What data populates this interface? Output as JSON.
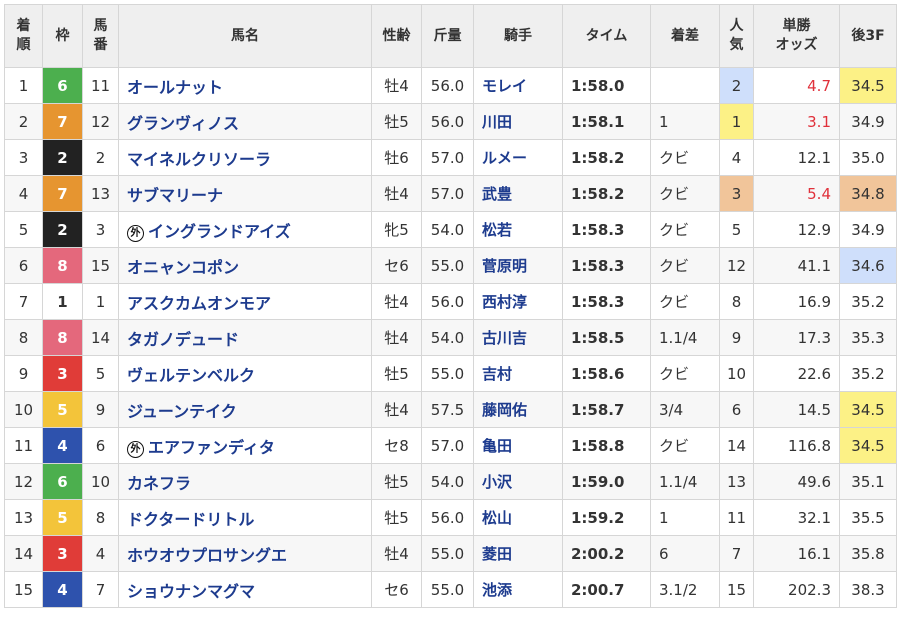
{
  "headers": {
    "rank": [
      "着",
      "順"
    ],
    "waku": "枠",
    "num": [
      "馬",
      "番"
    ],
    "name": "馬名",
    "sexage": "性齢",
    "weight": "斤量",
    "jockey": "騎手",
    "time": "タイム",
    "margin": "着差",
    "pop": [
      "人",
      "気"
    ],
    "odds": [
      "単勝",
      "オッズ"
    ],
    "last3f": "後3F"
  },
  "waku_colors": {
    "1": "#ffffff",
    "2": "#222222",
    "3": "#e03c38",
    "4": "#2e52ad",
    "5": "#f3c43a",
    "6": "#4caf4e",
    "7": "#e69530",
    "8": "#e4687c"
  },
  "rows": [
    {
      "rank": "1",
      "waku": "6",
      "num": "11",
      "foreign": false,
      "name": "オールナット",
      "sexage": "牡4",
      "weight": "56.0",
      "jockey": "モレイ",
      "time": "1:58.0",
      "margin": "",
      "pop": "2",
      "odds": "4.7",
      "last3f": "34.5",
      "f3rank": 1
    },
    {
      "rank": "2",
      "waku": "7",
      "num": "12",
      "foreign": false,
      "name": "グランヴィノス",
      "sexage": "牡5",
      "weight": "56.0",
      "jockey": "川田",
      "time": "1:58.1",
      "margin": "1",
      "pop": "1",
      "odds": "3.1",
      "last3f": "34.9",
      "f3rank": 0
    },
    {
      "rank": "3",
      "waku": "2",
      "num": "2",
      "foreign": false,
      "name": "マイネルクリソーラ",
      "sexage": "牡6",
      "weight": "57.0",
      "jockey": "ルメー",
      "time": "1:58.2",
      "margin": "クビ",
      "pop": "4",
      "odds": "12.1",
      "last3f": "35.0",
      "f3rank": 0
    },
    {
      "rank": "4",
      "waku": "7",
      "num": "13",
      "foreign": false,
      "name": "サブマリーナ",
      "sexage": "牡4",
      "weight": "57.0",
      "jockey": "武豊",
      "time": "1:58.2",
      "margin": "クビ",
      "pop": "3",
      "odds": "5.4",
      "last3f": "34.8",
      "f3rank": 3
    },
    {
      "rank": "5",
      "waku": "2",
      "num": "3",
      "foreign": true,
      "name": "イングランドアイズ",
      "sexage": "牝5",
      "weight": "54.0",
      "jockey": "松若",
      "time": "1:58.3",
      "margin": "クビ",
      "pop": "5",
      "odds": "12.9",
      "last3f": "34.9",
      "f3rank": 0
    },
    {
      "rank": "6",
      "waku": "8",
      "num": "15",
      "foreign": false,
      "name": "オニャンコポン",
      "sexage": "セ6",
      "weight": "55.0",
      "jockey": "菅原明",
      "time": "1:58.3",
      "margin": "クビ",
      "pop": "12",
      "odds": "41.1",
      "last3f": "34.6",
      "f3rank": 2
    },
    {
      "rank": "7",
      "waku": "1",
      "num": "1",
      "foreign": false,
      "name": "アスクカムオンモア",
      "sexage": "牡4",
      "weight": "56.0",
      "jockey": "西村淳",
      "time": "1:58.3",
      "margin": "クビ",
      "pop": "8",
      "odds": "16.9",
      "last3f": "35.2",
      "f3rank": 0
    },
    {
      "rank": "8",
      "waku": "8",
      "num": "14",
      "foreign": false,
      "name": "タガノデュード",
      "sexage": "牡4",
      "weight": "54.0",
      "jockey": "古川吉",
      "time": "1:58.5",
      "margin": "1.1/4",
      "pop": "9",
      "odds": "17.3",
      "last3f": "35.3",
      "f3rank": 0
    },
    {
      "rank": "9",
      "waku": "3",
      "num": "5",
      "foreign": false,
      "name": "ヴェルテンベルク",
      "sexage": "牡5",
      "weight": "55.0",
      "jockey": "吉村",
      "time": "1:58.6",
      "margin": "クビ",
      "pop": "10",
      "odds": "22.6",
      "last3f": "35.2",
      "f3rank": 0
    },
    {
      "rank": "10",
      "waku": "5",
      "num": "9",
      "foreign": false,
      "name": "ジューンテイク",
      "sexage": "牡4",
      "weight": "57.5",
      "jockey": "藤岡佑",
      "time": "1:58.7",
      "margin": "3/4",
      "pop": "6",
      "odds": "14.5",
      "last3f": "34.5",
      "f3rank": 1
    },
    {
      "rank": "11",
      "waku": "4",
      "num": "6",
      "foreign": true,
      "name": "エアファンディタ",
      "sexage": "セ8",
      "weight": "57.0",
      "jockey": "亀田",
      "time": "1:58.8",
      "margin": "クビ",
      "pop": "14",
      "odds": "116.8",
      "last3f": "34.5",
      "f3rank": 1
    },
    {
      "rank": "12",
      "waku": "6",
      "num": "10",
      "foreign": false,
      "name": "カネフラ",
      "sexage": "牡5",
      "weight": "54.0",
      "jockey": "小沢",
      "time": "1:59.0",
      "margin": "1.1/4",
      "pop": "13",
      "odds": "49.6",
      "last3f": "35.1",
      "f3rank": 0
    },
    {
      "rank": "13",
      "waku": "5",
      "num": "8",
      "foreign": false,
      "name": "ドクタードリトル",
      "sexage": "牡5",
      "weight": "56.0",
      "jockey": "松山",
      "time": "1:59.2",
      "margin": "1",
      "pop": "11",
      "odds": "32.1",
      "last3f": "35.5",
      "f3rank": 0
    },
    {
      "rank": "14",
      "waku": "3",
      "num": "4",
      "foreign": false,
      "name": "ホウオウプロサングエ",
      "sexage": "牡4",
      "weight": "55.0",
      "jockey": "菱田",
      "time": "2:00.2",
      "margin": "6",
      "pop": "7",
      "odds": "16.1",
      "last3f": "35.8",
      "f3rank": 0
    },
    {
      "rank": "15",
      "waku": "4",
      "num": "7",
      "foreign": false,
      "name": "ショウナンマグマ",
      "sexage": "セ6",
      "weight": "55.0",
      "jockey": "池添",
      "time": "2:00.7",
      "margin": "3.1/2",
      "pop": "15",
      "odds": "202.3",
      "last3f": "38.3",
      "f3rank": 0
    }
  ],
  "foreign_mark": "外"
}
